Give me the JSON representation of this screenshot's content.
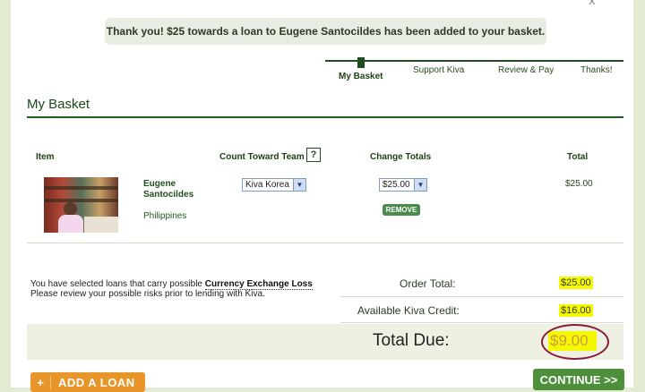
{
  "notice": {
    "message": "Thank you! $25 towards a loan to Eugene Santocildes has been added to your basket."
  },
  "steps": [
    {
      "label": "My Basket"
    },
    {
      "label": "Support Kiva"
    },
    {
      "label": "Review & Pay"
    },
    {
      "label": "Thanks!"
    }
  ],
  "basket": {
    "title": "My Basket",
    "columns": {
      "item": "Item",
      "team": "Count Toward Team",
      "help": "?",
      "change": "Change Totals",
      "total": "Total"
    },
    "row": {
      "borrower_line1": "Eugene",
      "borrower_line2": "Santocildes",
      "country": "Philippines",
      "team_selected": "Kiva Korea",
      "amount_selected": "$25.00",
      "remove_label": "REMOVE",
      "total": "$25.00"
    }
  },
  "warning": {
    "line1_prefix": "You have selected loans that carry possible",
    "link": "Currency Exchange Loss",
    "line2": "Please review your possible risks prior to lending with Kiva."
  },
  "summary": {
    "order_total_label": "Order Total:",
    "order_total": "$25.00",
    "credit_label": "Available Kiva Credit:",
    "credit": "$16.00",
    "due_label": "Total Due:",
    "due": "$9.00"
  },
  "actions": {
    "add_loan_icon": "+",
    "add_loan_label": "ADD A LOAN",
    "continue_label": "CONTINUE >>"
  },
  "close_icon": "x",
  "colors": {
    "accent_green": "#1f5a1f",
    "highlight": "#f6f800",
    "add_orange": "#e8962a",
    "continue_green": "#4e8f3c"
  }
}
